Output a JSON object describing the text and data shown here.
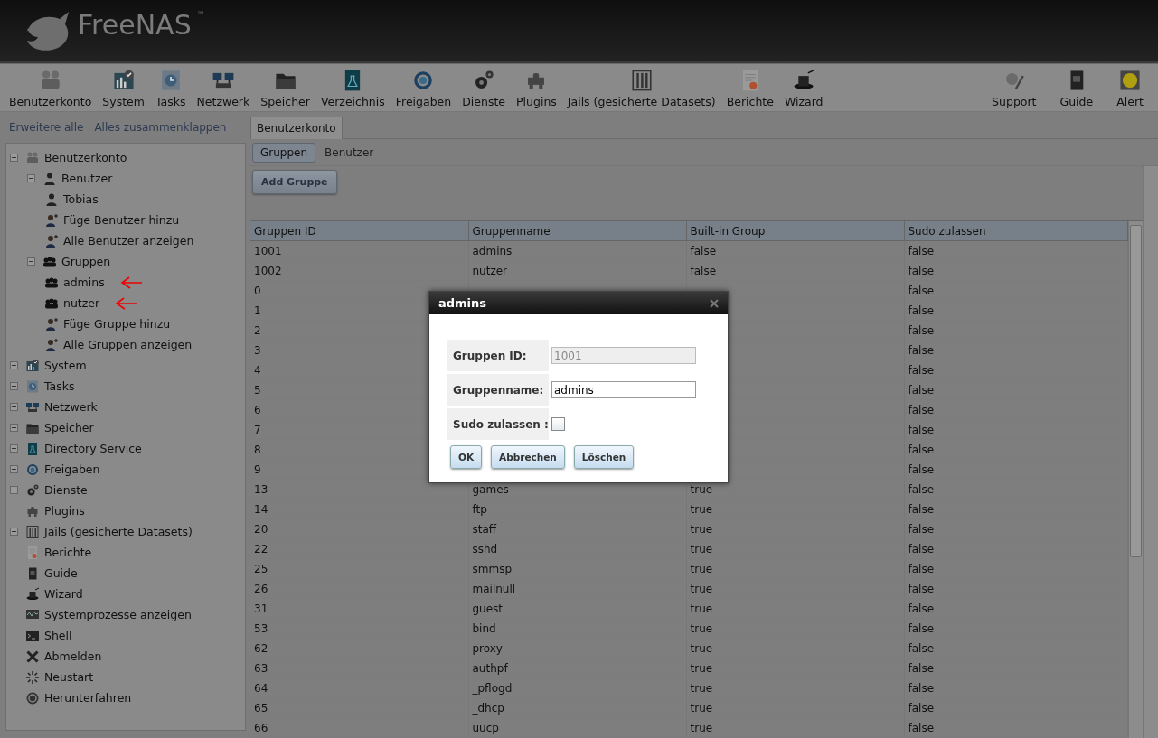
{
  "app": {
    "logo": "FreeNAS",
    "trademark": "™"
  },
  "toolbar": {
    "items": [
      {
        "label": "Benutzerkonto"
      },
      {
        "label": "System"
      },
      {
        "label": "Tasks"
      },
      {
        "label": "Netzwerk"
      },
      {
        "label": "Speicher"
      },
      {
        "label": "Verzeichnis"
      },
      {
        "label": "Freigaben"
      },
      {
        "label": "Dienste"
      },
      {
        "label": "Plugins"
      },
      {
        "label": "Jails (gesicherte Datasets)"
      },
      {
        "label": "Berichte"
      },
      {
        "label": "Wizard"
      }
    ],
    "right_items": [
      {
        "label": "Support"
      },
      {
        "label": "Guide"
      },
      {
        "label": "Alert"
      }
    ]
  },
  "sidebar": {
    "links": [
      "Erweitere alle",
      "Alles zusammenklappen"
    ],
    "items": [
      {
        "label": "Benutzerkonto",
        "expanded": true,
        "children": [
          {
            "label": "Benutzer",
            "expanded": true,
            "children": [
              {
                "label": "Tobias"
              },
              {
                "label": "Füge Benutzer hinzu"
              },
              {
                "label": "Alle Benutzer anzeigen"
              }
            ]
          },
          {
            "label": "Gruppen",
            "expanded": true,
            "children": [
              {
                "label": "admins",
                "annotated": true
              },
              {
                "label": "nutzer",
                "annotated": true
              },
              {
                "label": "Füge Gruppe hinzu"
              },
              {
                "label": "Alle Gruppen anzeigen"
              }
            ]
          }
        ]
      },
      {
        "label": "System",
        "expanded": false
      },
      {
        "label": "Tasks",
        "expanded": false
      },
      {
        "label": "Netzwerk",
        "expanded": false
      },
      {
        "label": "Speicher",
        "expanded": false
      },
      {
        "label": "Directory Service",
        "expanded": false
      },
      {
        "label": "Freigaben",
        "expanded": false
      },
      {
        "label": "Dienste",
        "expanded": false
      },
      {
        "label": "Plugins"
      },
      {
        "label": "Jails (gesicherte Datasets)",
        "expanded": false
      },
      {
        "label": "Berichte"
      },
      {
        "label": "Guide"
      },
      {
        "label": "Wizard"
      },
      {
        "label": "Systemprozesse anzeigen"
      },
      {
        "label": "Shell"
      },
      {
        "label": "Abmelden"
      },
      {
        "label": "Neustart"
      },
      {
        "label": "Herunterfahren"
      }
    ]
  },
  "tabs": [
    {
      "label": "Benutzerkonto",
      "selected": true
    }
  ],
  "subtabs": [
    {
      "label": "Gruppen",
      "selected": true
    },
    {
      "label": "Benutzer",
      "selected": false
    }
  ],
  "add_button": "Add Gruppe",
  "table": {
    "columns": [
      "Gruppen ID",
      "Gruppenname",
      "Built-in Group",
      "Sudo zulassen"
    ],
    "rows": [
      {
        "id": "1001",
        "name": "admins",
        "builtin": "false",
        "sudo": "false"
      },
      {
        "id": "1002",
        "name": "nutzer",
        "builtin": "false",
        "sudo": "false"
      },
      {
        "id": "0",
        "sudo": "false"
      },
      {
        "id": "1",
        "sudo": "false"
      },
      {
        "id": "2",
        "sudo": "false"
      },
      {
        "id": "3",
        "sudo": "false"
      },
      {
        "id": "4",
        "sudo": "false"
      },
      {
        "id": "5",
        "sudo": "false"
      },
      {
        "id": "6",
        "sudo": "false"
      },
      {
        "id": "7",
        "sudo": "false"
      },
      {
        "id": "8",
        "sudo": "false"
      },
      {
        "id": "9",
        "sudo": "false"
      },
      {
        "id": "13",
        "name": "games",
        "builtin": "true",
        "sudo": "false"
      },
      {
        "id": "14",
        "name": "ftp",
        "builtin": "true",
        "sudo": "false"
      },
      {
        "id": "20",
        "name": "staff",
        "builtin": "true",
        "sudo": "false"
      },
      {
        "id": "22",
        "name": "sshd",
        "builtin": "true",
        "sudo": "false"
      },
      {
        "id": "25",
        "name": "smmsp",
        "builtin": "true",
        "sudo": "false"
      },
      {
        "id": "26",
        "name": "mailnull",
        "builtin": "true",
        "sudo": "false"
      },
      {
        "id": "31",
        "name": "guest",
        "builtin": "true",
        "sudo": "false"
      },
      {
        "id": "53",
        "name": "bind",
        "builtin": "true",
        "sudo": "false"
      },
      {
        "id": "62",
        "name": "proxy",
        "builtin": "true",
        "sudo": "false"
      },
      {
        "id": "63",
        "name": "authpf",
        "builtin": "true",
        "sudo": "false"
      },
      {
        "id": "64",
        "name": "_pflogd",
        "builtin": "true",
        "sudo": "false"
      },
      {
        "id": "65",
        "name": "_dhcp",
        "builtin": "true",
        "sudo": "false"
      },
      {
        "id": "66",
        "name": "uucp",
        "builtin": "true",
        "sudo": "false"
      }
    ]
  },
  "dialog": {
    "title": "admins",
    "fields": [
      {
        "kind": "text",
        "label": "Gruppen ID:",
        "value": "1001",
        "disabled": true
      },
      {
        "kind": "text",
        "label": "Gruppenname:",
        "value": "admins",
        "disabled": false
      },
      {
        "kind": "checkbox",
        "label": "Sudo zulassen :",
        "checked": false
      }
    ],
    "buttons": [
      "OK",
      "Abbrechen",
      "Löschen"
    ]
  }
}
